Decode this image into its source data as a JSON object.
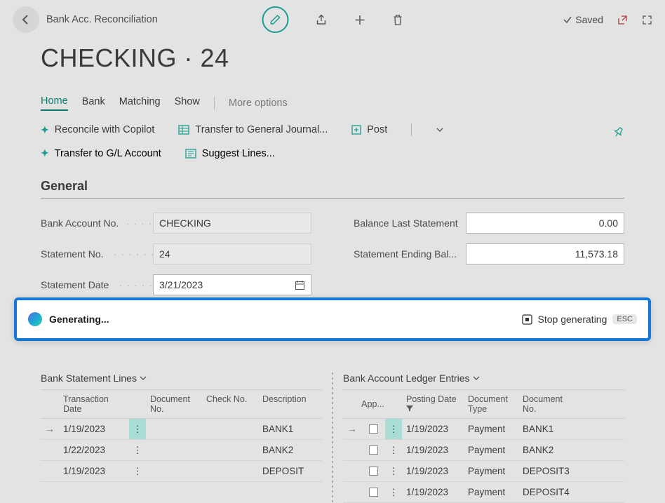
{
  "topbar": {
    "title": "Bank Acc. Reconciliation",
    "saved_label": "Saved"
  },
  "page_title": "CHECKING · 24",
  "menu": {
    "home": "Home",
    "bank": "Bank",
    "matching": "Matching",
    "show": "Show",
    "more": "More options"
  },
  "actions": {
    "reconcile_copilot": "Reconcile with Copilot",
    "transfer_journal": "Transfer to General Journal...",
    "post": "Post",
    "transfer_gl": "Transfer to G/L Account",
    "suggest_lines": "Suggest Lines..."
  },
  "general": {
    "heading": "General",
    "labels": {
      "bank_account_no": "Bank Account No.",
      "statement_no": "Statement No.",
      "statement_date": "Statement Date",
      "balance_last": "Balance Last Statement",
      "ending_bal": "Statement Ending Bal..."
    },
    "values": {
      "bank_account_no": "CHECKING",
      "statement_no": "24",
      "statement_date": "3/21/2023",
      "balance_last": "0.00",
      "ending_bal": "11,573.18"
    }
  },
  "copilot": {
    "status": "Generating...",
    "stop": "Stop generating",
    "esc": "ESC"
  },
  "left_table": {
    "title": "Bank Statement Lines",
    "headers": {
      "trans_date": "Transaction Date",
      "doc_no": "Document No.",
      "check_no": "Check No.",
      "desc": "Description"
    },
    "rows": [
      {
        "date": "1/19/2023",
        "doc": "",
        "check": "",
        "desc": "BANK1",
        "active": true
      },
      {
        "date": "1/22/2023",
        "doc": "",
        "check": "",
        "desc": "BANK2",
        "active": false
      },
      {
        "date": "1/19/2023",
        "doc": "",
        "check": "",
        "desc": "DEPOSIT",
        "active": false
      }
    ]
  },
  "right_table": {
    "title": "Bank Account Ledger Entries",
    "headers": {
      "app": "App...",
      "posting_date": "Posting Date",
      "doc_type": "Document Type",
      "doc_no": "Document No."
    },
    "rows": [
      {
        "date": "1/19/2023",
        "type": "Payment",
        "doc": "BANK1",
        "active": true
      },
      {
        "date": "1/19/2023",
        "type": "Payment",
        "doc": "BANK2",
        "active": false
      },
      {
        "date": "1/19/2023",
        "type": "Payment",
        "doc": "DEPOSIT3",
        "active": false
      },
      {
        "date": "1/19/2023",
        "type": "Payment",
        "doc": "DEPOSIT4",
        "active": false
      }
    ]
  }
}
